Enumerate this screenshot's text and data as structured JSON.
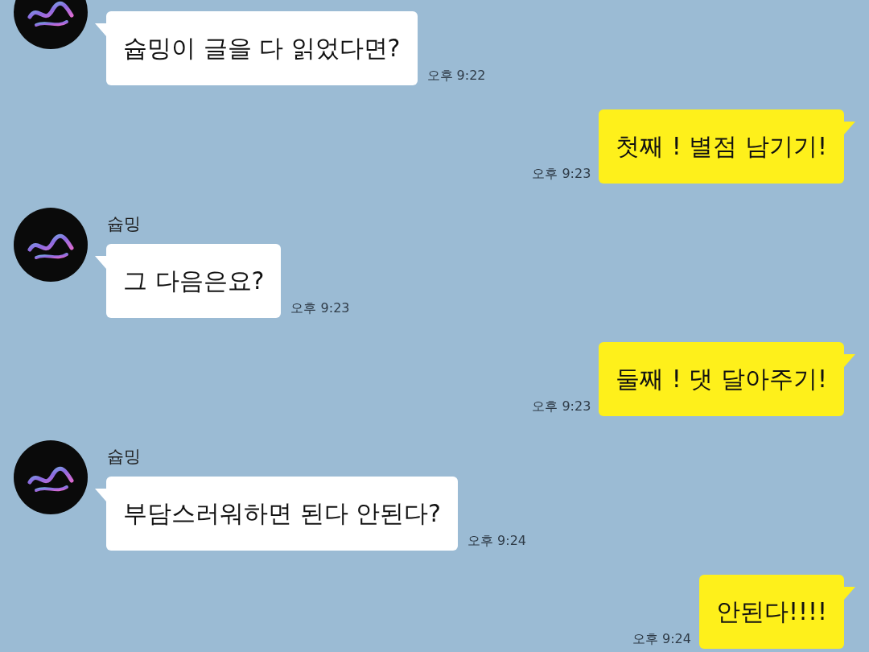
{
  "messages": [
    {
      "kind": "received",
      "text": "슙밍이 글을 다 읽었다면?",
      "time": "오후 9:22"
    },
    {
      "kind": "sent",
      "text": "첫째 ! 별점 남기기!",
      "time": "오후 9:23"
    },
    {
      "kind": "received",
      "name": "슙밍",
      "text": "그 다음은요?",
      "time": "오후 9:23"
    },
    {
      "kind": "sent",
      "text": "둘째 ! 댓 달아주기!",
      "time": "오후 9:23"
    },
    {
      "kind": "received",
      "name": "슙밍",
      "text": "부담스러워하면 된다 안된다?",
      "time": "오후 9:24"
    },
    {
      "kind": "sent",
      "text": "안된다!!!!",
      "time": "오후 9:24"
    }
  ]
}
